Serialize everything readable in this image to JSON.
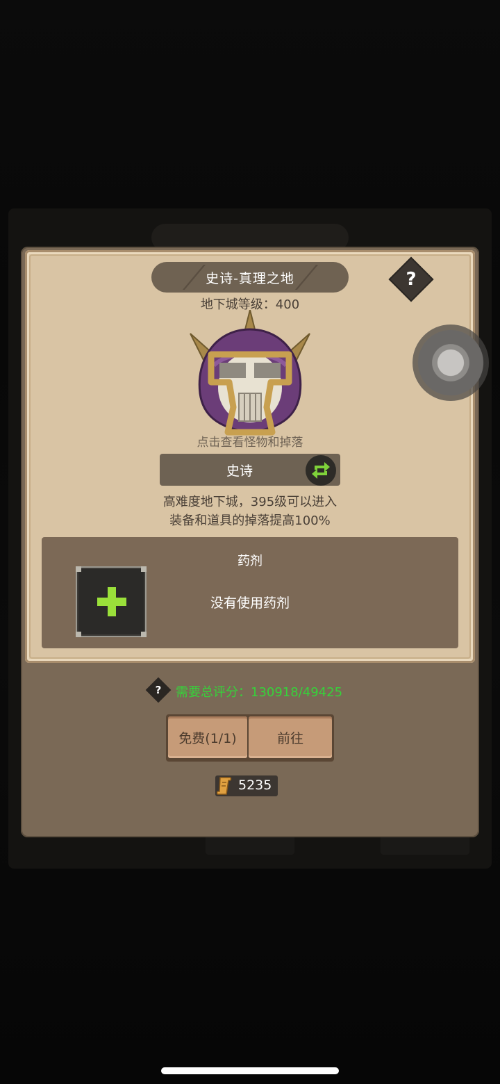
{
  "dialog": {
    "title": "史诗-真理之地",
    "help_symbol": "?",
    "dungeon_level_label": "地下城等级：400",
    "monster_icon": "purple-helmet-skull-icon",
    "monster_hint": "点击查看怪物和掉落",
    "difficulty": "史诗",
    "swap_icon": "swap-arrows-icon",
    "desc_line1": "高难度地下城，395级可以进入",
    "desc_line2": "装备和道具的掉落提高100%"
  },
  "potion": {
    "title": "药剂",
    "empty_text": "没有使用药剂",
    "add_icon": "plus-icon"
  },
  "score": {
    "help_symbol": "?",
    "text": "需要总评分：130918/49425",
    "color": "#36d33a"
  },
  "actions": {
    "free_label": "免费(1/1)",
    "go_label": "前往"
  },
  "currency": {
    "icon": "scroll-icon",
    "value": "5235"
  }
}
